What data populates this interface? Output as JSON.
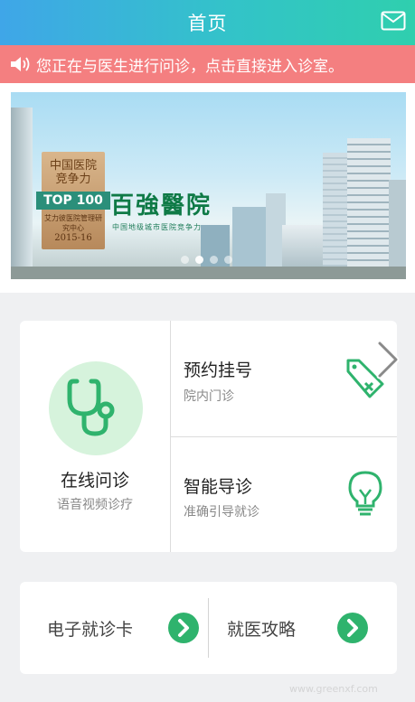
{
  "header": {
    "title": "首页",
    "mail_icon": "mail-icon"
  },
  "notice": {
    "text": "您正在与医生进行问诊，点击直接进入诊室。",
    "icon": "speaker-icon"
  },
  "banner": {
    "badge_line1": "中国医院",
    "badge_line2": "竞争力",
    "badge_ribbon": "TOP 100",
    "badge_line4": "艾力彼医院管理研究中心",
    "badge_line5": "2015-16",
    "hospital_name": "百強醫院",
    "hospital_sub": "中国地级城市医院竞争力",
    "slide_count": 4,
    "active_slide": 1
  },
  "services": {
    "online": {
      "label": "在线问诊",
      "sub": "语音视频诊疗",
      "icon": "stethoscope-icon"
    },
    "appointment": {
      "label": "预约挂号",
      "sub": "院内门诊",
      "icon": "tag-icon"
    },
    "guide": {
      "label": "智能导诊",
      "sub": "准确引导就诊",
      "icon": "lightbulb-icon"
    }
  },
  "shortcuts": {
    "card": {
      "label": "电子就诊卡",
      "icon": "arrow-right-icon"
    },
    "strategy": {
      "label": "就医攻略",
      "icon": "arrow-right-icon"
    }
  },
  "watermark": "www.greenxf.com",
  "colors": {
    "accent_green": "#2fb36d",
    "notice_bg": "#f47f80",
    "header_start": "#3fa6e8",
    "header_end": "#2fcfae"
  }
}
